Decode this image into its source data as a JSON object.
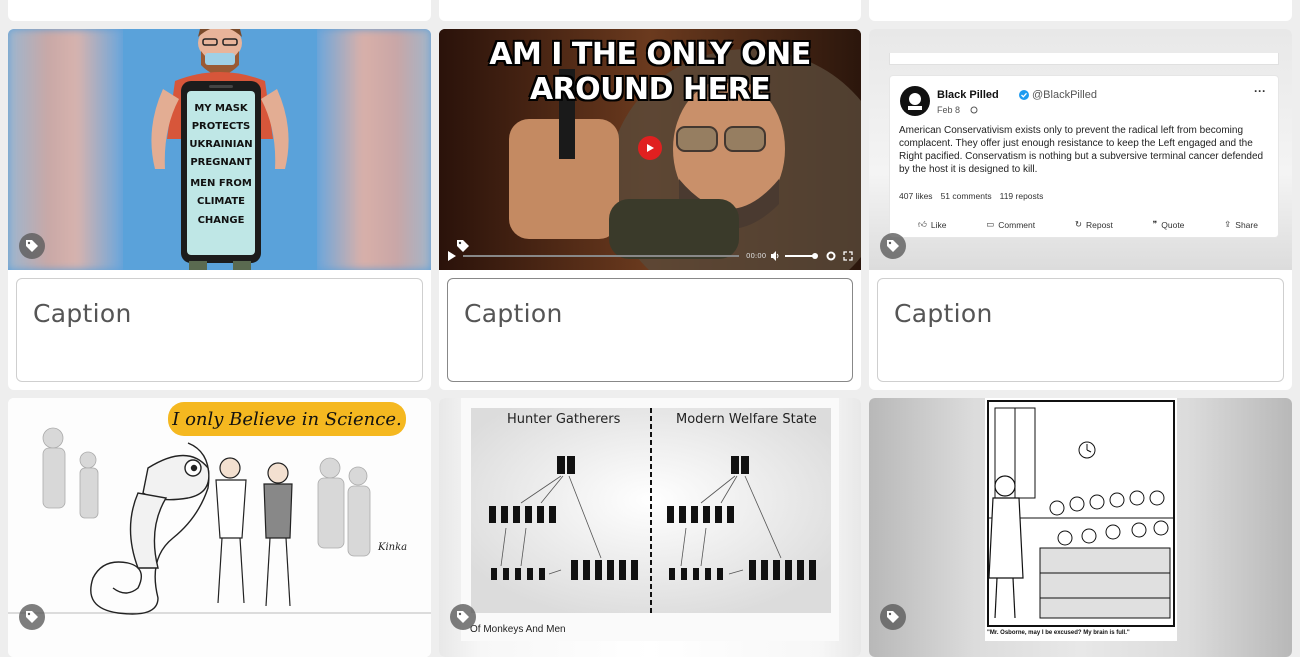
{
  "cards": [
    {
      "caption_placeholder": "Caption",
      "image_text": [
        "MY MASK",
        "PROTECTS",
        "UKRAINIAN",
        "PREGNANT",
        "MEN FROM",
        "CLIMATE",
        "CHANGE"
      ]
    },
    {
      "caption_placeholder": "Caption",
      "video_title": "AM I THE ONLY ONE AROUND HERE",
      "video_time": "00:00"
    },
    {
      "caption_placeholder": "Caption",
      "tweet": {
        "name": "Black Pilled",
        "handle": "@BlackPilled",
        "date": "Feb 8",
        "body": "American Conservativism exists only to prevent the radical left from becoming complacent. They offer just enough resistance to keep the Left engaged and the Right pacified. Conservatism is nothing but a subversive terminal cancer defended by the host it is designed to kill.",
        "likes": "407 likes",
        "comments": "51 comments",
        "reposts": "119 reposts",
        "actions": [
          "Like",
          "Comment",
          "Repost",
          "Quote",
          "Share"
        ]
      }
    },
    {
      "speech": "I only Believe in Science.",
      "signature": "Kinka"
    },
    {
      "left_title": "Hunter Gatherers",
      "right_title": "Modern Welfare State",
      "caption": "Of Monkeys And Men"
    },
    {
      "comic_caption": "\"Mr. Osborne, may I be excused? My brain is full.\""
    }
  ]
}
